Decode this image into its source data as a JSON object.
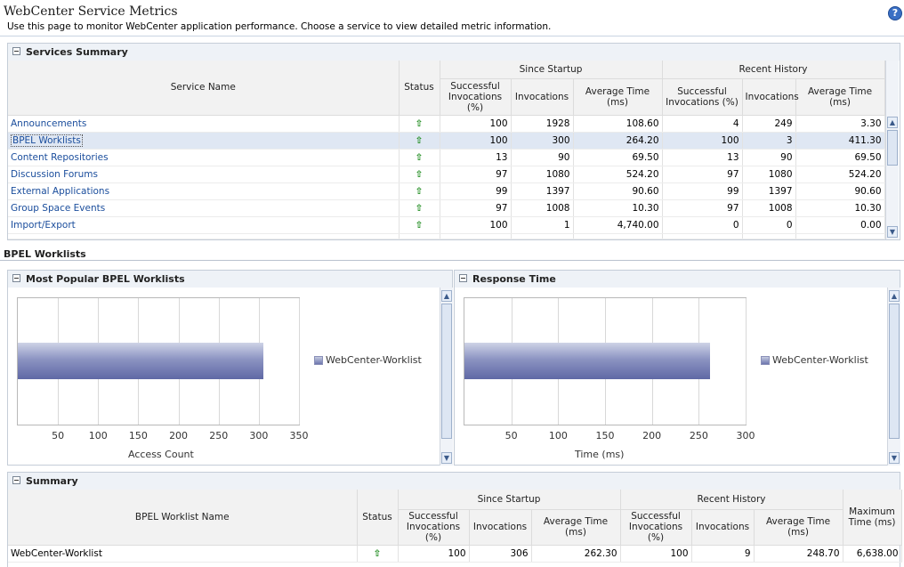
{
  "page": {
    "title": "WebCenter Service Metrics",
    "description": "Use this page to monitor WebCenter application performance. Choose a service to view detailed metric information.",
    "help_label": "?"
  },
  "services_summary": {
    "title": "Services Summary",
    "columns": {
      "service_name": "Service Name",
      "status": "Status",
      "since_startup": "Since Startup",
      "recent_history": "Recent History",
      "successful": "Successful Invocations (%)",
      "invocations": "Invocations",
      "average_time": "Average Time (ms)"
    },
    "rows": [
      {
        "name": "Announcements",
        "status": "up",
        "s_succ": "100",
        "s_inv": "1928",
        "s_avg": "108.60",
        "r_succ": "4",
        "r_inv": "249",
        "r_avg": "3.30"
      },
      {
        "name": "BPEL Worklists",
        "status": "up",
        "s_succ": "100",
        "s_inv": "300",
        "s_avg": "264.20",
        "r_succ": "100",
        "r_inv": "3",
        "r_avg": "411.30"
      },
      {
        "name": "Content Repositories",
        "status": "up",
        "s_succ": "13",
        "s_inv": "90",
        "s_avg": "69.50",
        "r_succ": "13",
        "r_inv": "90",
        "r_avg": "69.50"
      },
      {
        "name": "Discussion Forums",
        "status": "up",
        "s_succ": "97",
        "s_inv": "1080",
        "s_avg": "524.20",
        "r_succ": "97",
        "r_inv": "1080",
        "r_avg": "524.20"
      },
      {
        "name": "External Applications",
        "status": "up",
        "s_succ": "99",
        "s_inv": "1397",
        "s_avg": "90.60",
        "r_succ": "99",
        "r_inv": "1397",
        "r_avg": "90.60"
      },
      {
        "name": "Group Space Events",
        "status": "up",
        "s_succ": "97",
        "s_inv": "1008",
        "s_avg": "10.30",
        "r_succ": "97",
        "r_inv": "1008",
        "r_avg": "10.30"
      },
      {
        "name": "Import/Export",
        "status": "up",
        "s_succ": "100",
        "s_inv": "1",
        "s_avg": "4,740.00",
        "r_succ": "0",
        "r_inv": "0",
        "r_avg": "0.00"
      }
    ],
    "selected_row": "BPEL Worklists"
  },
  "detail_section": {
    "title": "BPEL Worklists"
  },
  "popular_panel": {
    "title": "Most Popular BPEL Worklists"
  },
  "response_panel": {
    "title": "Response Time"
  },
  "chart_data": [
    {
      "type": "bar",
      "orientation": "horizontal",
      "categories": [
        ""
      ],
      "series": [
        {
          "name": "WebCenter-Worklist",
          "values": [
            306
          ]
        }
      ],
      "xlabel": "Access Count",
      "xlim": [
        0,
        350
      ],
      "xticks": [
        50,
        100,
        150,
        200,
        250,
        300,
        350
      ],
      "grid": true,
      "legend": "right",
      "bar_color": "#6f78b0"
    },
    {
      "type": "bar",
      "orientation": "horizontal",
      "categories": [
        ""
      ],
      "series": [
        {
          "name": "WebCenter-Worklist",
          "values": [
            262.3
          ]
        }
      ],
      "xlabel": "Time (ms)",
      "xlim": [
        0,
        300
      ],
      "xticks": [
        50,
        100,
        150,
        200,
        250,
        300
      ],
      "grid": true,
      "legend": "right",
      "bar_color": "#6f78b0"
    }
  ],
  "summary": {
    "title": "Summary",
    "columns": {
      "worklist_name": "BPEL Worklist Name",
      "status": "Status",
      "since_startup": "Since Startup",
      "recent_history": "Recent History",
      "successful": "Successful Invocations (%)",
      "invocations": "Invocations",
      "average_time": "Average Time (ms)",
      "maximum_time": "Maximum Time (ms)"
    },
    "rows": [
      {
        "name": "WebCenter-Worklist",
        "status": "up",
        "s_succ": "100",
        "s_inv": "306",
        "s_avg": "262.30",
        "r_succ": "100",
        "r_inv": "9",
        "r_avg": "248.70",
        "max": "6,638.00"
      }
    ]
  },
  "icons": {
    "status_up": "up-arrow-icon",
    "collapse": "collapse-icon",
    "help": "help-icon"
  },
  "colors": {
    "link": "#1a4d9c",
    "status_up": "#1b8a1b",
    "selected_row": "#dfe7f3",
    "panel_header": "#eef2f7"
  }
}
